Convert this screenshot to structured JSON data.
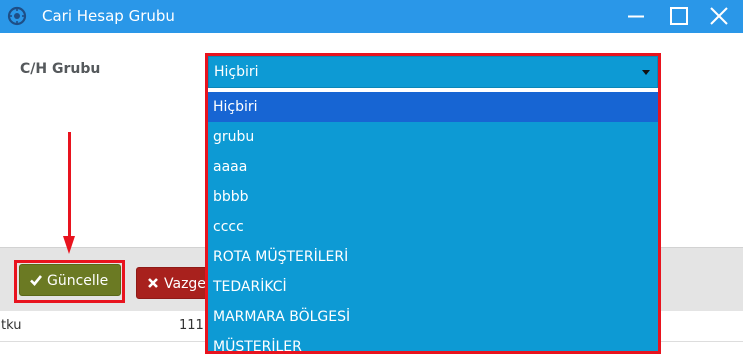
{
  "window": {
    "title": "Cari Hesap Grubu",
    "icon": "app-logo-icon",
    "controls": [
      "minimize-icon",
      "maximize-icon",
      "close-icon"
    ]
  },
  "form": {
    "field_label": "C/H Grubu",
    "select": {
      "selected_value": "Hiçbiri",
      "options": [
        "Hiçbiri",
        "grubu",
        "aaaa",
        "bbbb",
        "cccc",
        "ROTA MÜŞTERİLERİ",
        "TEDARİKCİ",
        "MARMARA BÖLGESİ",
        "MÜŞTERİLER"
      ],
      "highlighted_index": 0
    }
  },
  "buttons": {
    "update_label": "Güncelle",
    "update_icon": "check-icon",
    "cancel_label": "Vazgeç",
    "cancel_icon": "times-icon"
  },
  "background_table": {
    "rows": [
      {
        "col1": "tku",
        "col2": "111"
      }
    ]
  },
  "colors": {
    "titlebar": "#2a97e8",
    "select_background": "#0d9ad4",
    "option_highlight": "#1765d3",
    "update_button": "#6b7a23",
    "cancel_button": "#a8211d",
    "annotation": "#e8131e"
  }
}
